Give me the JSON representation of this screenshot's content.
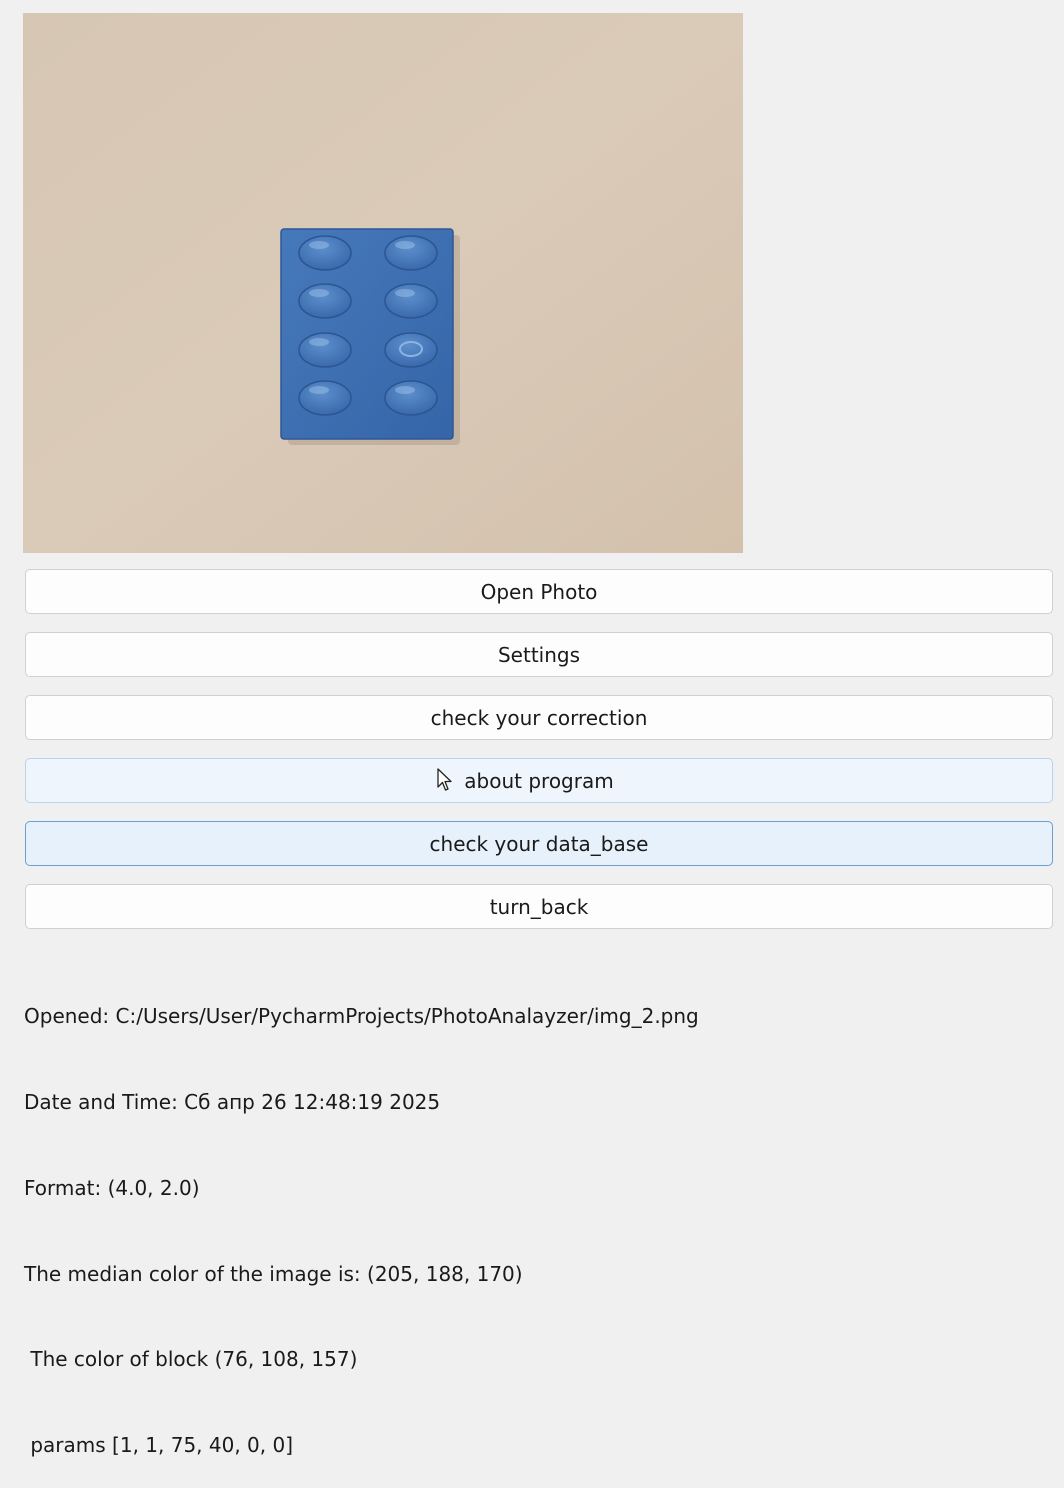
{
  "buttons": {
    "open_photo": "Open Photo",
    "settings": "Settings",
    "check_correction": "check your correction",
    "about_program": "about program",
    "check_data_base": "check your data_base",
    "turn_back": "turn_back"
  },
  "info": {
    "opened": "Opened: C:/Users/User/PycharmProjects/PhotoAnalayzer/img_2.png",
    "date_time": "Date and Time: Сб апр 26 12:48:19 2025",
    "format": "Format: (4.0, 2.0)",
    "median_color": "The median color of the image is: (205, 188, 170)",
    "block_color": " The color of block (76, 108, 157)",
    "params": " params [1, 1, 75, 40, 0, 0]"
  },
  "colors": {
    "window_bg": "#f0f0f0",
    "photo_bg": "#d7c7b4",
    "block": "#3b6db0",
    "button_hover": "#eef5fc",
    "button_focus_border": "#6a9fd4"
  },
  "icons": {
    "cursor": "mouse-pointer-icon"
  }
}
